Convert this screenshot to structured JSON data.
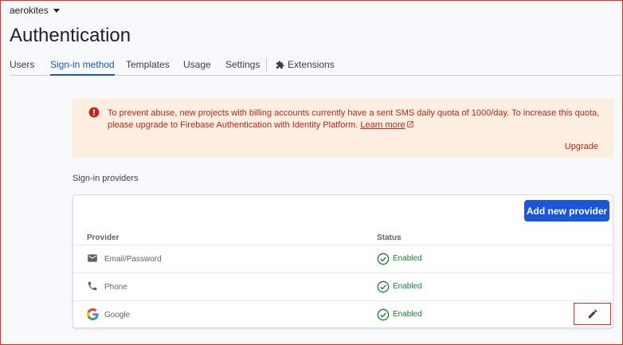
{
  "project": {
    "name": "aerokites"
  },
  "page": {
    "title": "Authentication"
  },
  "tabs": [
    {
      "label": "Users"
    },
    {
      "label": "Sign-in method"
    },
    {
      "label": "Templates"
    },
    {
      "label": "Usage"
    },
    {
      "label": "Settings"
    },
    {
      "label": "Extensions"
    }
  ],
  "banner": {
    "text": "To prevent abuse, new projects with billing accounts currently have a sent SMS daily quota of 1000/day. To increase this quota, please upgrade to Firebase Authentication with Identity Platform.",
    "link": "Learn more",
    "action": "Upgrade"
  },
  "providers": {
    "section_title": "Sign-in providers",
    "add_button": "Add new provider",
    "columns": {
      "provider": "Provider",
      "status": "Status"
    },
    "rows": [
      {
        "name": "Email/Password",
        "icon": "mail-icon",
        "status": "Enabled"
      },
      {
        "name": "Phone",
        "icon": "phone-icon",
        "status": "Enabled"
      },
      {
        "name": "Google",
        "icon": "google-logo-icon",
        "status": "Enabled"
      }
    ]
  },
  "colors": {
    "accent": "#1a56d6",
    "warning_bg": "#fdefe0",
    "warning_text": "#b3261e",
    "enabled": "#1e7a35"
  }
}
